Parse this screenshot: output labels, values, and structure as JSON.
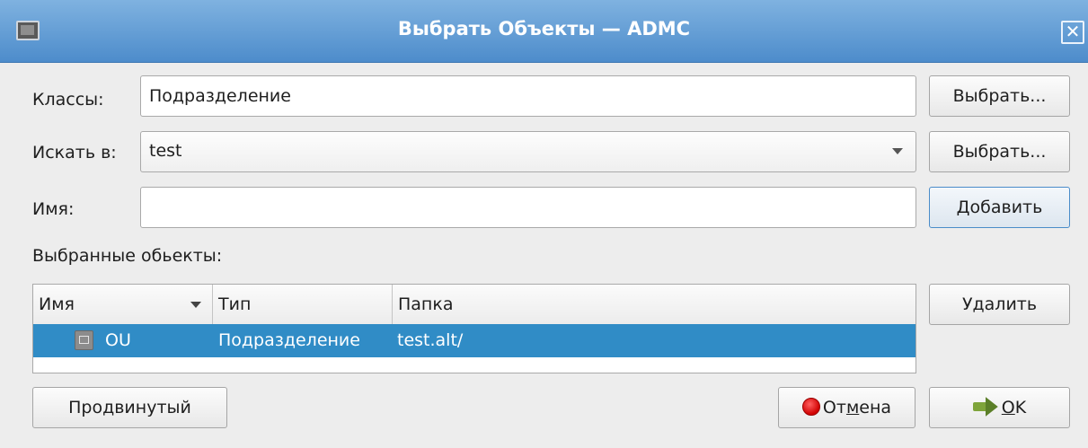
{
  "window": {
    "title": "Выбрать Объекты — ADMC",
    "close_glyph": "✕"
  },
  "form": {
    "classes_label": "Классы:",
    "classes_value": "Подразделение",
    "search_in_label": "Искать в:",
    "search_in_value": "test",
    "name_label": "Имя:",
    "name_value": "",
    "select_button_1": "Выбрать...",
    "select_button_2": "Выбрать...",
    "add_button": "Добавить"
  },
  "selected": {
    "label": "Выбранные обьекты:",
    "columns": [
      "Имя",
      "Тип",
      "Папка"
    ],
    "rows": [
      {
        "name": "OU",
        "type": "Подразделение",
        "folder": "test.alt/",
        "icon": "ou-folder-icon"
      }
    ],
    "remove_button": "Удалить"
  },
  "footer": {
    "advanced_button": "Продвинутый",
    "cancel_pre": "От",
    "cancel_mnemonic": "м",
    "cancel_post": "ена",
    "ok_mnemonic": "O",
    "ok_post": "K"
  },
  "colors": {
    "titlebar": "#4d8ccb",
    "selection": "#308cc6"
  }
}
